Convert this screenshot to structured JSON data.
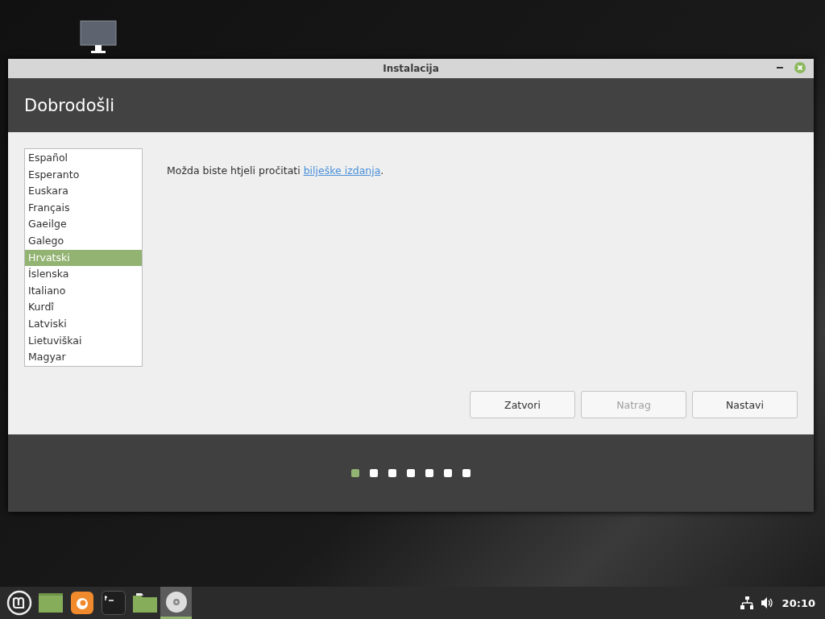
{
  "window": {
    "title": "Instalacija"
  },
  "header": {
    "title": "Dobrodošli"
  },
  "languages": [
    {
      "label": "Español",
      "selected": false
    },
    {
      "label": "Esperanto",
      "selected": false
    },
    {
      "label": "Euskara",
      "selected": false
    },
    {
      "label": "Français",
      "selected": false
    },
    {
      "label": "Gaeilge",
      "selected": false
    },
    {
      "label": "Galego",
      "selected": false
    },
    {
      "label": "Hrvatski",
      "selected": true
    },
    {
      "label": "Íslenska",
      "selected": false
    },
    {
      "label": "Italiano",
      "selected": false
    },
    {
      "label": "Kurdî",
      "selected": false
    },
    {
      "label": "Latviski",
      "selected": false
    },
    {
      "label": "Lietuviškai",
      "selected": false
    },
    {
      "label": "Magyar",
      "selected": false
    }
  ],
  "message": {
    "text": "Možda biste htjeli pročitati ",
    "link": "bilješke izdanja",
    "end": "."
  },
  "buttons": [
    {
      "label": "Zatvori",
      "disabled": false
    },
    {
      "label": "Natrag",
      "disabled": true
    },
    {
      "label": "Nastavi",
      "disabled": false
    }
  ],
  "steps": [
    {
      "selected": true
    },
    {
      "selected": false
    },
    {
      "selected": false
    },
    {
      "selected": false
    },
    {
      "selected": false
    },
    {
      "selected": false
    },
    {
      "selected": false
    }
  ],
  "taskbar": {
    "clock": "20:10"
  }
}
